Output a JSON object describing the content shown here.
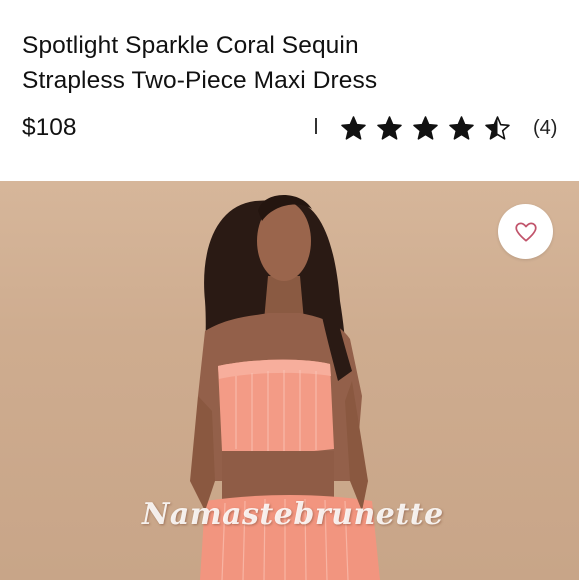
{
  "product": {
    "title_line1": "Spotlight Sparkle Coral Sequin",
    "title_line2": "Strapless Two-Piece Maxi Dress",
    "price": "$108",
    "rating": 4.5,
    "rating_max": 5,
    "review_count": "(4)"
  },
  "image": {
    "watermark": "Namastebrunette",
    "favorite_icon": "heart-icon"
  },
  "colors": {
    "accent_heart": "#c1546b",
    "star": "#111111",
    "dress_coral": "#f29a86"
  }
}
